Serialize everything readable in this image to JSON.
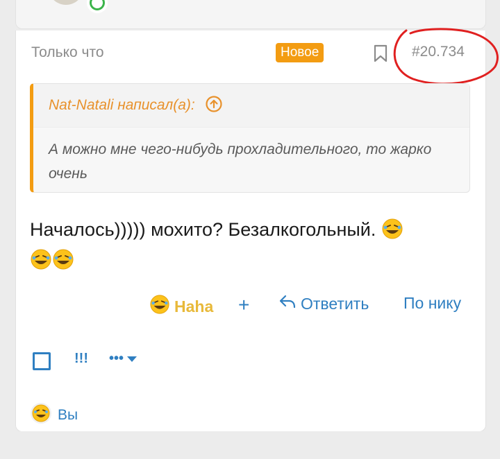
{
  "post": {
    "time": "Только что",
    "badge": "Новое",
    "number": "#20.734",
    "quote": {
      "author": "Nat-Natali написал(а):",
      "text": "А можно мне чего-нибудь прохладительного, то жарко очень"
    },
    "message_line1": "Началось))))) мохито? Безалкогольный.",
    "actions": {
      "reaction_label": "Haha",
      "add_label": "+",
      "reply_label": "Ответить",
      "nick_label": "По нику"
    },
    "tools": {
      "report_label": "!!!",
      "more_label": "•••"
    },
    "reactors_label": "Вы"
  },
  "colors": {
    "accent": "#2f7fc1",
    "badge": "#f39c12",
    "quote_border": "#f39c12",
    "annotation_circle": "#e02020"
  }
}
